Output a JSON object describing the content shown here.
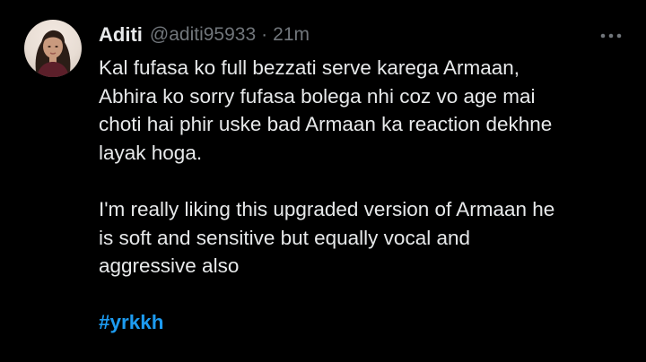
{
  "tweet": {
    "author": {
      "name": "Aditi",
      "handle": "@aditi95933",
      "separator": "·",
      "time": "21m"
    },
    "body": {
      "lines_p1": [
        "Kal fufasa ko full bezzati serve karega Armaan,",
        "Abhira ko sorry fufasa bolega nhi coz vo age mai",
        "choti hai phir uske bad Armaan ka reaction dekhne",
        "layak hoga."
      ],
      "lines_p2": [
        "I'm really liking this upgraded version of Armaan he",
        "is soft and sensitive but equally vocal and",
        "aggressive also"
      ],
      "hashtag": "#yrkkh"
    },
    "icons": {
      "avatar": "profile-photo",
      "more": "more-horizontal-icon"
    },
    "colors": {
      "background": "#000000",
      "text": "#e7e9ea",
      "muted": "#71767b",
      "link": "#1d9bf0"
    }
  }
}
